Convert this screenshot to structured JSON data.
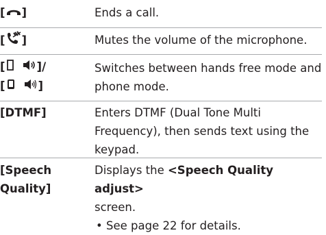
{
  "rows": [
    {
      "key_open": "[",
      "key_icon": "end-call-icon",
      "key_close": "]",
      "desc": "Ends a call."
    },
    {
      "key_open": "[",
      "key_icon": "mute-microphone-icon",
      "key_close": "]",
      "desc": "Mutes the volume of the microphone."
    },
    {
      "key_line1_open": "[",
      "key_line1_icon1": "phone-outline-icon",
      "key_line1_icon2": "speaker-icon",
      "key_line1_close": "]/",
      "key_line2_open": "[",
      "key_line2_icon1": "phone-filled-icon",
      "key_line2_icon2": "speaker-outline-icon",
      "key_line2_close": "]",
      "desc": "Switches between hands free mode and phone mode."
    },
    {
      "key": "[DTMF]",
      "desc": "Enters DTMF (Dual Tone Multi Frequency), then sends text using the keypad."
    },
    {
      "key_line1": "[Speech",
      "key_line2": "Quality]",
      "desc_line1_pre": "Displays the ",
      "desc_line1_bold": "<Speech Quality adjust>",
      "desc_line2": "screen.",
      "bullet": "•",
      "bullet_text": "See page 22 for details."
    }
  ]
}
